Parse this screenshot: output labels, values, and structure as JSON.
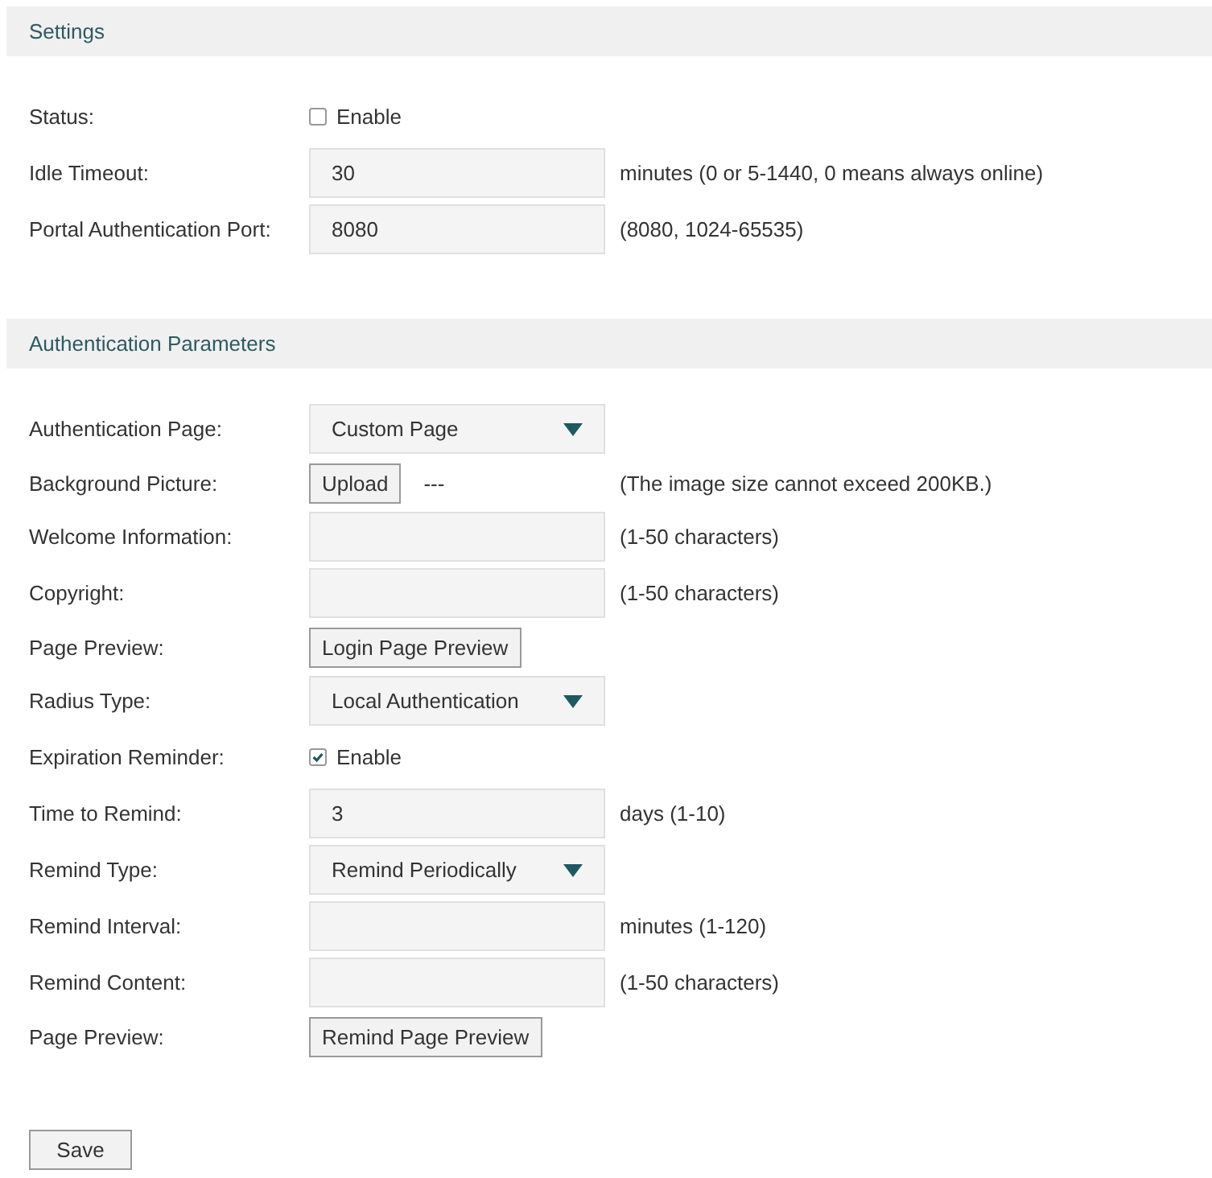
{
  "sections": [
    {
      "title": "Settings",
      "rows": [
        {
          "kind": "checkbox",
          "label": "Status:",
          "checked": false,
          "text": "Enable"
        },
        {
          "kind": "input",
          "label": "Idle Timeout:",
          "value": "30",
          "hint": "minutes (0 or 5-1440, 0 means always online)"
        },
        {
          "kind": "input",
          "label": "Portal Authentication Port:",
          "value": "8080",
          "hint": "(8080, 1024-65535)"
        }
      ]
    },
    {
      "title": "Authentication Parameters",
      "rows": [
        {
          "kind": "select",
          "label": "Authentication Page:",
          "value": "Custom Page"
        },
        {
          "kind": "upload",
          "label": "Background Picture:",
          "button": "Upload",
          "file_name": "---",
          "hint": "(The image size cannot exceed 200KB.)"
        },
        {
          "kind": "input",
          "label": "Welcome Information:",
          "hint": "(1-50 characters)"
        },
        {
          "kind": "input",
          "label": "Copyright:",
          "hint": "(1-50 characters)"
        },
        {
          "kind": "button",
          "label": "Page Preview:",
          "button": "Login Page Preview"
        },
        {
          "kind": "select",
          "label": "Radius Type:",
          "value": "Local Authentication"
        },
        {
          "kind": "checkbox",
          "label": "Expiration Reminder:",
          "checked": true,
          "text": "Enable"
        },
        {
          "kind": "input",
          "label": "Time to Remind:",
          "value": "3",
          "hint": "days (1-10)"
        },
        {
          "kind": "select",
          "label": "Remind Type:",
          "value": "Remind Periodically"
        },
        {
          "kind": "input",
          "label": "Remind Interval:",
          "hint": "minutes (1-120)"
        },
        {
          "kind": "input",
          "label": "Remind Content:",
          "hint": "(1-50 characters)"
        },
        {
          "kind": "button",
          "label": "Page Preview:",
          "button": "Remind Page Preview"
        }
      ]
    }
  ],
  "save_button": "Save"
}
